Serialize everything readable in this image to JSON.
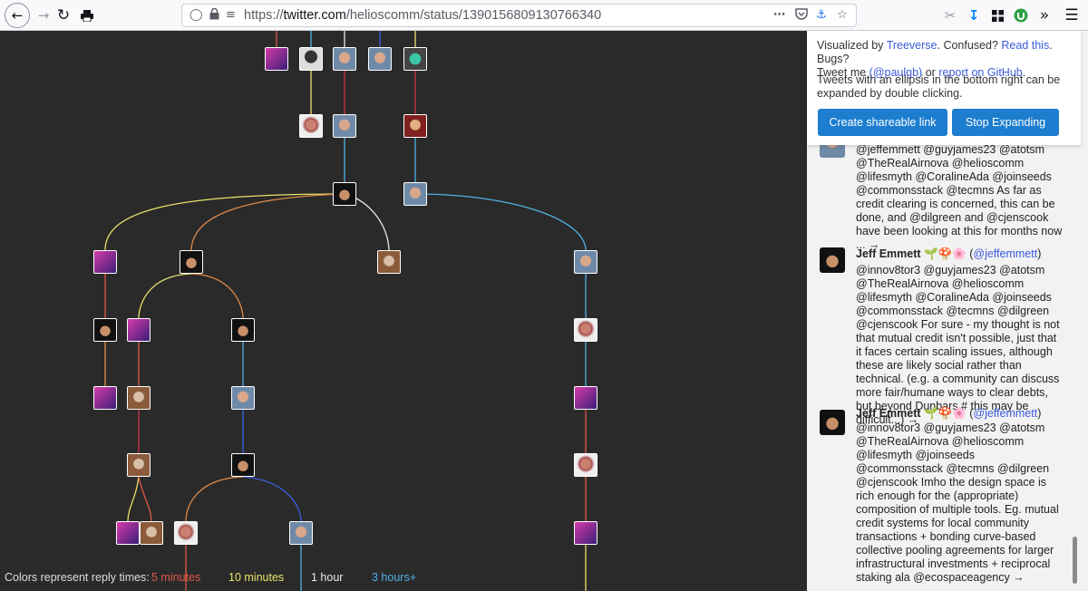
{
  "browser": {
    "url_prefix": "https://",
    "url_host": "twitter.com",
    "url_path": "/helioscomm/status/1390156809130766340",
    "icons": [
      "back-arrow-icon",
      "forward-arrow-icon",
      "reload-icon",
      "print-icon",
      "shield-icon",
      "lock-icon",
      "tracking-icon",
      "more-icon",
      "pocket-icon",
      "translate-icon",
      "star-icon",
      "screenshot-icon",
      "download-icon",
      "extensions-icon",
      "vpn-icon",
      "overflow-icon",
      "menu-icon"
    ]
  },
  "legend": {
    "label": "Colors represent reply times:",
    "items": [
      {
        "text": "5 minutes",
        "color": "#e0584a"
      },
      {
        "text": "10 minutes",
        "color": "#e8e26a"
      },
      {
        "text": "1 hour",
        "color": "#e8e8e8"
      },
      {
        "text": "3 hours+",
        "color": "#4fb3e6"
      }
    ]
  },
  "info": {
    "visualized_by": "Visualized by",
    "treeverse": "Treeverse",
    "confused": ". Confused?",
    "read_this": "Read this",
    "bugs": ". Bugs?",
    "tweet_me": "Tweet me",
    "handle": "(@paulgb)",
    "or": "or",
    "report": "report on GitHub",
    "period": ".",
    "expand_note": "Tweets with an ellipsis in the bottom right can be expanded by double clicking.",
    "share_button": "Create shareable link",
    "stop_button": "Stop Expanding"
  },
  "tweets": [
    {
      "author": "",
      "handle": "",
      "text": "@jeffemmett @guyjames23 @atotsm @TheRealAirnova @helioscomm @lifesmyth @CoralineAda @joinseeds @commonsstack @tecmns As far as credit clearing is concerned, this can be done, and @dilgreen and @cjenscook have been looking at this for months now ... →"
    },
    {
      "author": "Jeff Emmett",
      "emoji": "🌱🍄🌸",
      "handle": "@jeffemmett",
      "text": "@innov8tor3 @guyjames23 @atotsm @TheRealAirnova @helioscomm @lifesmyth @CoralineAda @joinseeds @commonsstack @tecmns @dilgreen @cjenscook For sure - my thought is not that mutual credit isn't possible, just that it faces certain scaling issues, although these are likely social rather than technical. (e.g. a community can discuss more fair/humane ways to clear debts, but beyond Dunbars # this may be difficult...) →"
    },
    {
      "author": "Jeff Emmett",
      "emoji": "🌱🍄🌸",
      "handle": "@jeffemmett",
      "text": "@innov8tor3 @guyjames23 @atotsm @TheRealAirnova @helioscomm @lifesmyth @joinseeds @commonsstack @tecmns @dilgreen @cjenscook Imho the design space is rich enough for the (appropriate) composition of multiple tools. Eg. mutual credit systems for local community transactions + bonding curve-based collective pooling agreements for larger infrastructural investments + reciprocal staking ala @ecospaceagency →"
    }
  ]
}
